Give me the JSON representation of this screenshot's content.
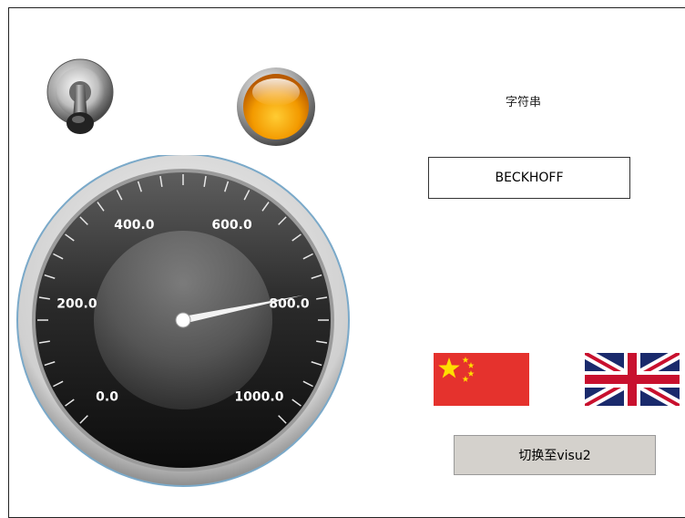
{
  "string_display": {
    "label": "字符串",
    "value": "BECKHOFF"
  },
  "switch_button": {
    "label": "切换至visu2"
  },
  "gauge": {
    "min": 0,
    "max": 1000,
    "value": 790,
    "tick_labels": [
      "0.0",
      "200.0",
      "400.0",
      "600.0",
      "800.0",
      "1000.0"
    ]
  },
  "language_flags": {
    "chinese": "flag-china-icon",
    "english": "flag-uk-icon"
  },
  "colors": {
    "lamp": "#f39a00",
    "button_bg": "#d4d1cc",
    "flag_red": "#e5322d",
    "flag_yellow": "#ffde00",
    "uk_blue": "#1a2a6c",
    "uk_red": "#c8102e"
  }
}
